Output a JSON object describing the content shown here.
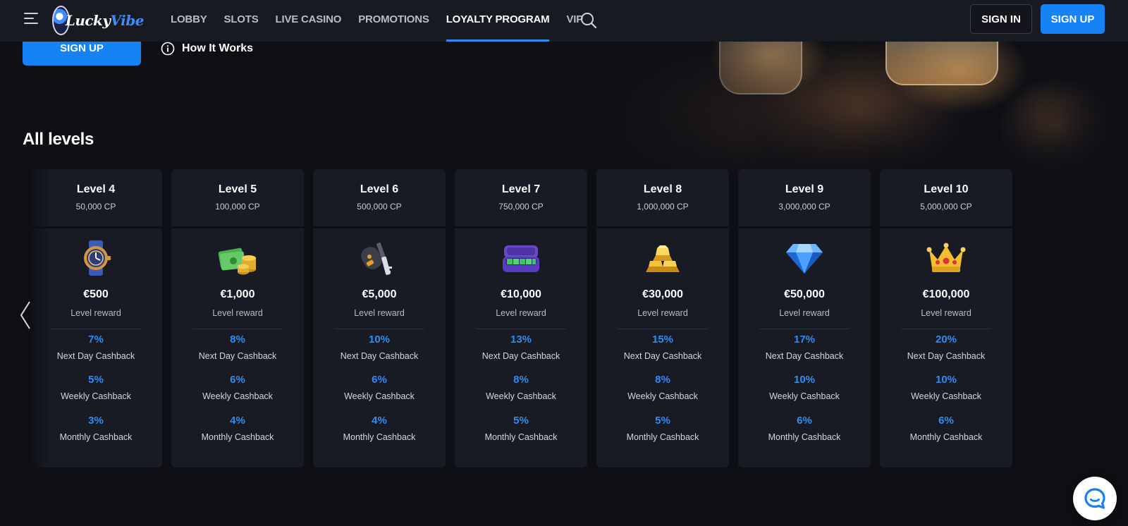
{
  "header": {
    "logo_text": "Lucky",
    "logo_text_accent": "Vibe",
    "nav": [
      {
        "label": "LOBBY",
        "active": false
      },
      {
        "label": "SLOTS",
        "active": false
      },
      {
        "label": "LIVE CASINO",
        "active": false
      },
      {
        "label": "PROMOTIONS",
        "active": false
      },
      {
        "label": "LOYALTY PROGRAM",
        "active": true
      },
      {
        "label": "VIP",
        "active": false
      }
    ],
    "sign_in": "SIGN IN",
    "sign_up": "SIGN UP"
  },
  "hero": {
    "sign_up": "SIGN UP",
    "how_it_works": "How It Works"
  },
  "section_title": "All levels",
  "labels": {
    "level_reward": "Level reward",
    "next_day": "Next Day Cashback",
    "weekly": "Weekly Cashback",
    "monthly": "Monthly Cashback"
  },
  "levels": [
    {
      "name": "Level 4",
      "cp": "50,000 CP",
      "reward": "€500",
      "icon": "watch-icon",
      "next_day": "7%",
      "weekly": "5%",
      "monthly": "3%"
    },
    {
      "name": "Level 5",
      "cp": "100,000 CP",
      "reward": "€1,000",
      "icon": "cash-coins-icon",
      "next_day": "8%",
      "weekly": "6%",
      "monthly": "4%"
    },
    {
      "name": "Level 6",
      "cp": "500,000 CP",
      "reward": "€5,000",
      "icon": "car-key-icon",
      "next_day": "10%",
      "weekly": "6%",
      "monthly": "4%"
    },
    {
      "name": "Level 7",
      "cp": "750,000 CP",
      "reward": "€10,000",
      "icon": "money-case-icon",
      "next_day": "13%",
      "weekly": "8%",
      "monthly": "5%"
    },
    {
      "name": "Level 8",
      "cp": "1,000,000 CP",
      "reward": "€30,000",
      "icon": "gold-bars-icon",
      "next_day": "15%",
      "weekly": "8%",
      "monthly": "5%"
    },
    {
      "name": "Level 9",
      "cp": "3,000,000 CP",
      "reward": "€50,000",
      "icon": "diamond-icon",
      "next_day": "17%",
      "weekly": "10%",
      "monthly": "6%"
    },
    {
      "name": "Level 10",
      "cp": "5,000,000 CP",
      "reward": "€100,000",
      "icon": "crown-icon",
      "next_day": "20%",
      "weekly": "10%",
      "monthly": "6%"
    }
  ],
  "colors": {
    "accent": "#1582f5",
    "percent_blue": "#2f8cf0",
    "card_bg": "#191b24",
    "page_bg": "#0e0f15"
  }
}
